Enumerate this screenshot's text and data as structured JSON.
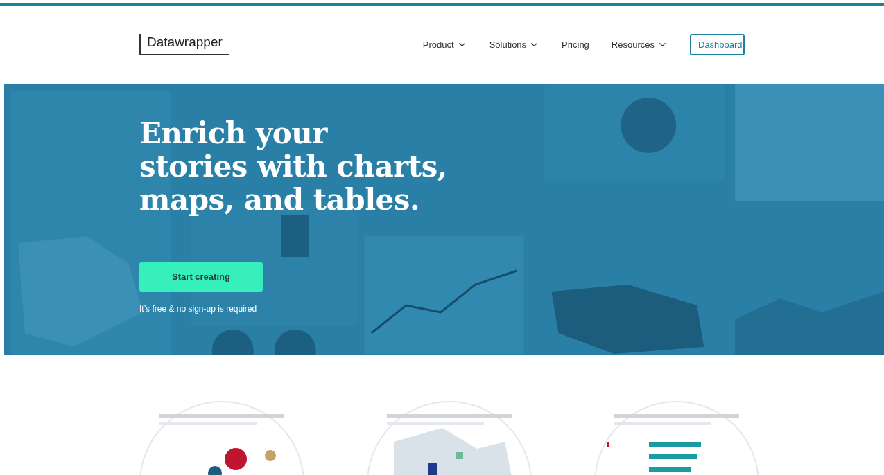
{
  "header": {
    "logo": "Datawrapper",
    "nav": [
      {
        "label": "Product",
        "has_menu": true
      },
      {
        "label": "Solutions",
        "has_menu": true
      },
      {
        "label": "Pricing",
        "has_menu": false
      },
      {
        "label": "Resources",
        "has_menu": true
      }
    ],
    "cta": "Dashboard"
  },
  "hero": {
    "headline": [
      "Enrich your",
      "stories with charts,",
      "maps, and tables."
    ],
    "button": "Start creating",
    "note": "It’s free & no sign-up is required"
  }
}
